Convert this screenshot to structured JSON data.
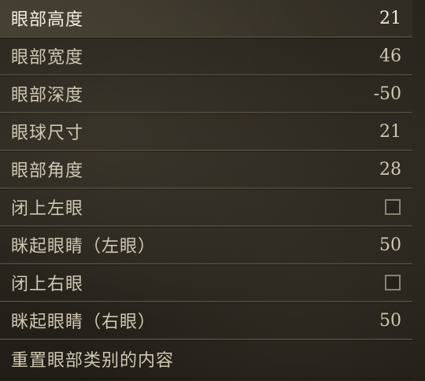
{
  "rows": [
    {
      "label": "眼部高度",
      "value": "21",
      "type": "slider"
    },
    {
      "label": "眼部宽度",
      "value": "46",
      "type": "slider"
    },
    {
      "label": "眼部深度",
      "value": "-50",
      "type": "slider"
    },
    {
      "label": "眼球尺寸",
      "value": "21",
      "type": "slider"
    },
    {
      "label": "眼部角度",
      "value": "28",
      "type": "slider"
    },
    {
      "label": "闭上左眼",
      "checked": false,
      "type": "checkbox"
    },
    {
      "label": "眯起眼睛（左眼）",
      "value": "50",
      "type": "slider"
    },
    {
      "label": "闭上右眼",
      "checked": false,
      "type": "checkbox"
    },
    {
      "label": "眯起眼睛（右眼）",
      "value": "50",
      "type": "slider"
    },
    {
      "label": "重置眼部类别的内容",
      "type": "action"
    }
  ],
  "selected_row_index": 0
}
